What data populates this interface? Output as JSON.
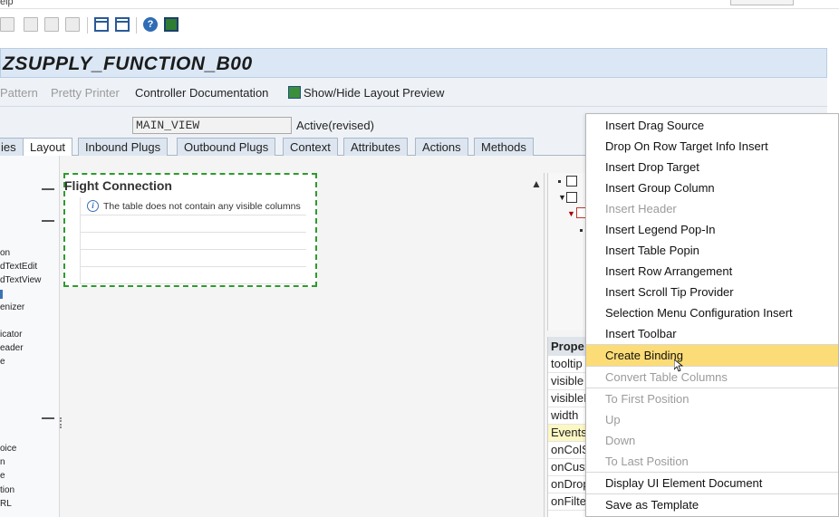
{
  "menubar": {
    "item": "elp"
  },
  "toolbar": {
    "icons": [
      "new-icon",
      "open-icon",
      "save-icon",
      "save-as-icon",
      "layout-icon",
      "window-icon",
      "help-icon",
      "monitor-icon"
    ]
  },
  "header": {
    "title": "ZSUPPLY_FUNCTION_B00"
  },
  "app_toolbar": {
    "pattern": "Pattern",
    "pretty_printer": "Pretty Printer",
    "controller_doc": "Controller Documentation",
    "layout_preview": "Show/Hide Layout Preview"
  },
  "view": {
    "name": "MAIN_VIEW",
    "status": "Active(revised)"
  },
  "tabs": [
    {
      "label": "ies"
    },
    {
      "label": "Layout"
    },
    {
      "label": "Inbound Plugs"
    },
    {
      "label": "Outbound Plugs"
    },
    {
      "label": "Context"
    },
    {
      "label": "Attributes"
    },
    {
      "label": "Actions"
    },
    {
      "label": "Methods"
    }
  ],
  "left_tree": {
    "items": [
      "on",
      "dTextEdit",
      "dTextView",
      "enizer",
      "icator",
      "eader",
      "e",
      "oice",
      "n",
      "e",
      "tion",
      "RL"
    ]
  },
  "canvas": {
    "table_title": "Flight Connection",
    "empty_message": "The table does not contain any visible columns"
  },
  "properties": {
    "header": "Prope",
    "rows": [
      "tooltip",
      "visible",
      "visibleI",
      "width",
      "Events",
      "onColS",
      "onCust",
      "onDrop",
      "onFilte"
    ]
  },
  "context_menu": {
    "items": [
      {
        "label": "Insert Drag Source",
        "disabled": false
      },
      {
        "label": "Drop On Row Target Info Insert",
        "disabled": false
      },
      {
        "label": "Insert Drop Target",
        "disabled": false
      },
      {
        "label": "Insert Group Column",
        "disabled": false
      },
      {
        "label": "Insert Header",
        "disabled": true
      },
      {
        "label": "Insert Legend Pop-In",
        "disabled": false
      },
      {
        "label": "Insert Table Popin",
        "disabled": false
      },
      {
        "label": "Insert Row Arrangement",
        "disabled": false
      },
      {
        "label": "Insert Scroll Tip Provider",
        "disabled": false
      },
      {
        "label": "Selection Menu Configuration Insert",
        "disabled": false
      },
      {
        "label": "Insert Toolbar",
        "disabled": false
      },
      {
        "label": "Create Binding",
        "disabled": false,
        "highlighted": true
      },
      {
        "label": "Convert Table Columns",
        "disabled": true
      },
      {
        "label": "To First Position",
        "disabled": true
      },
      {
        "label": "Up",
        "disabled": true
      },
      {
        "label": "Down",
        "disabled": true
      },
      {
        "label": "To Last Position",
        "disabled": true
      },
      {
        "label": "Display UI Element Document",
        "disabled": false
      },
      {
        "label": "Save as Template",
        "disabled": false
      }
    ]
  },
  "colors": {
    "highlight": "#fbdc76",
    "title_bar": "#dbe7f4",
    "canvas_border": "#2f9a2f"
  }
}
